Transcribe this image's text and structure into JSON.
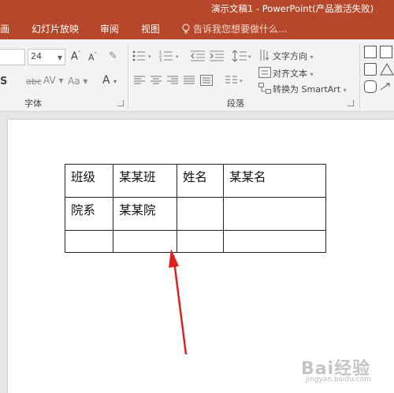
{
  "titlebar": {
    "title": "演示文稿1 - PowerPoint(产品激活失败)"
  },
  "tabs": [
    {
      "label": "画"
    },
    {
      "label": "幻灯片放映"
    },
    {
      "label": "审阅"
    },
    {
      "label": "视图"
    }
  ],
  "tell_me": {
    "label": "告诉我您想要做什么..."
  },
  "ribbon": {
    "font_group": {
      "label": "字体",
      "size_value": "24"
    },
    "paragraph_group": {
      "label": "段落",
      "text_direction_label": "文字方向",
      "align_text_label": "对齐文本",
      "smartart_label": "转换为 SmartArt"
    }
  },
  "table": {
    "rows": [
      [
        "班级",
        "某某班",
        "姓名",
        "某某名"
      ],
      [
        "院系",
        "某某院",
        "",
        ""
      ],
      [
        "",
        "",
        "",
        ""
      ]
    ]
  },
  "annotation": {
    "arrow_color": "#e02020"
  },
  "watermark": {
    "text": "Bai经验",
    "url": "jingyan.baidu.com"
  },
  "colors": {
    "accent": "#b7472a",
    "ribbon_bg": "#f3f3f3",
    "workspace_bg": "#e6e6e6"
  }
}
